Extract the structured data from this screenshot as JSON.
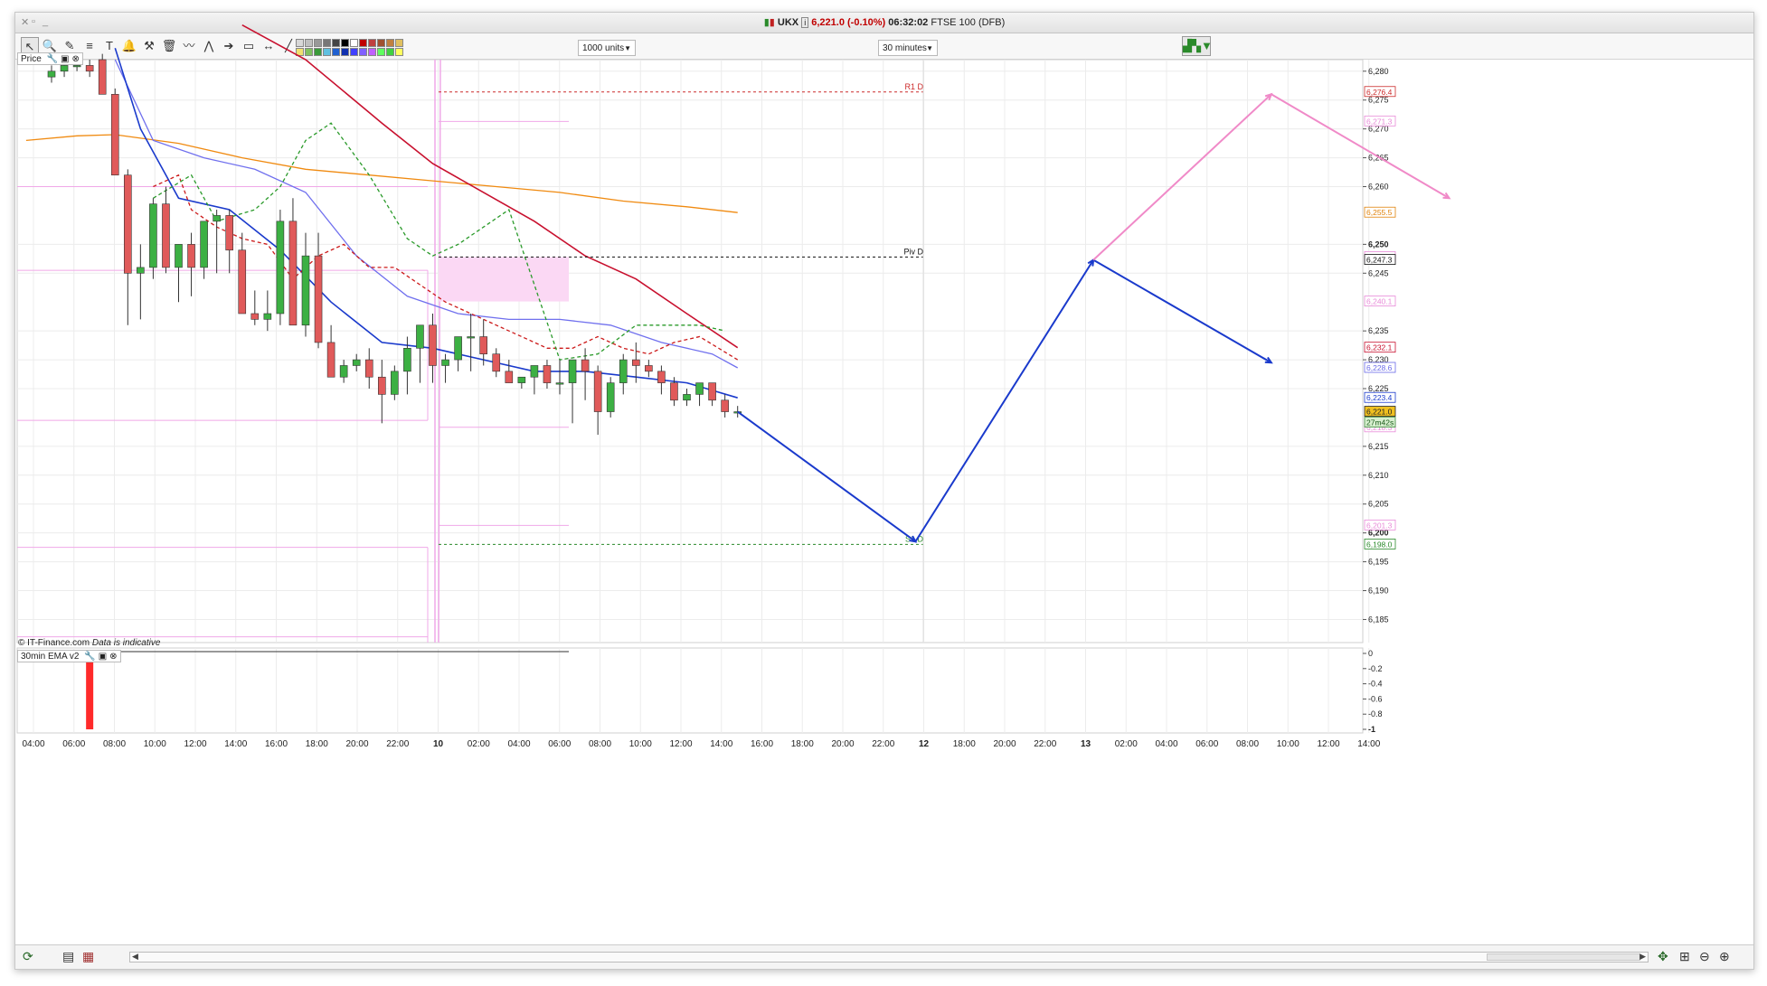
{
  "titlebar": {
    "symbol": "UKX",
    "info_icon": "info-icon",
    "price": "6,221.0",
    "change": "(-0.10%)",
    "time": "06:32:02",
    "name": "FTSE 100 (DFB)"
  },
  "toolbar": {
    "units_label": "1000 units",
    "interval_label": "30 minutes",
    "tools": [
      "cursor-icon",
      "zoom-icon",
      "draw-icon",
      "fibonacci-icon",
      "text-icon",
      "alert-icon",
      "tools-icon",
      "delete-icon",
      "indicator-icon",
      "pattern-icon",
      "arrow-icon",
      "shape-icon",
      "line-icon",
      "pen-icon"
    ],
    "palette": [
      "#d8d8d8",
      "#bfbfbf",
      "#999999",
      "#777777",
      "#444444",
      "#000000",
      "#ffffff",
      "#c00000",
      "#c04040",
      "#a05030",
      "#c08040",
      "#e0c060",
      "#f0e070",
      "#80c060",
      "#3a9a3a",
      "#60c0e0",
      "#2060d0",
      "#1030b0",
      "#4040ff",
      "#8060ff",
      "#c060ff",
      "#60ff60",
      "#40d040",
      "#ffff60"
    ],
    "chart_type_icon": "chart-type-icon"
  },
  "pane_labels": {
    "price": "Price",
    "ema": "30min EMA v2",
    "copyright": "© IT-Finance.com",
    "disclaimer": "Data is indicative"
  },
  "bottombar": {
    "tools": [
      "refresh-icon",
      "layout-icon",
      "layers-icon"
    ],
    "right_tools": [
      "crosshair-icon",
      "zoom-fit-icon",
      "zoom-out-icon",
      "zoom-in-icon"
    ]
  },
  "chart_data": {
    "type": "candlestick",
    "title": "UKX FTSE 100 (DFB)",
    "interval": "30 minutes",
    "ylim": [
      6181,
      6282
    ],
    "y_ticks": [
      "6,280",
      "6,275",
      "6,270",
      "6,265",
      "6,260",
      "6,250",
      "6,245",
      "6,235",
      "6,230",
      "6,225",
      "6,215",
      "6,210",
      "6,205",
      "6,200",
      "6,195",
      "6,190",
      "6,185"
    ],
    "bold_y_ticks": [
      "6,250",
      "6,200"
    ],
    "x_tick_labels": [
      "04:00",
      "06:00",
      "08:00",
      "10:00",
      "12:00",
      "14:00",
      "16:00",
      "18:00",
      "20:00",
      "22:00",
      "10",
      "02:00",
      "04:00",
      "06:00",
      "08:00",
      "10:00",
      "12:00",
      "14:00",
      "16:00",
      "18:00",
      "20:00",
      "22:00",
      "12",
      "18:00",
      "20:00",
      "22:00",
      "13",
      "02:00",
      "04:00",
      "06:00",
      "08:00",
      "10:00",
      "12:00",
      "14:00"
    ],
    "bold_x_ticks": [
      "10",
      "12",
      "13"
    ],
    "candles": [
      {
        "t": 0,
        "o": 6279,
        "h": 6281,
        "l": 6278,
        "c": 6280
      },
      {
        "t": 1,
        "o": 6280,
        "h": 6282,
        "l": 6279,
        "c": 6281
      },
      {
        "t": 2,
        "o": 6281,
        "h": 6282,
        "l": 6280,
        "c": 6281
      },
      {
        "t": 3,
        "o": 6281,
        "h": 6282,
        "l": 6279,
        "c": 6280
      },
      {
        "t": 4,
        "o": 6282,
        "h": 6283,
        "l": 6276,
        "c": 6276
      },
      {
        "t": 5,
        "o": 6276,
        "h": 6277,
        "l": 6262,
        "c": 6262
      },
      {
        "t": 6,
        "o": 6262,
        "h": 6263,
        "l": 6236,
        "c": 6245
      },
      {
        "t": 7,
        "o": 6245,
        "h": 6250,
        "l": 6237,
        "c": 6246
      },
      {
        "t": 8,
        "o": 6246,
        "h": 6258,
        "l": 6244,
        "c": 6257
      },
      {
        "t": 9,
        "o": 6257,
        "h": 6260,
        "l": 6245,
        "c": 6246
      },
      {
        "t": 10,
        "o": 6246,
        "h": 6250,
        "l": 6240,
        "c": 6250
      },
      {
        "t": 11,
        "o": 6250,
        "h": 6252,
        "l": 6241,
        "c": 6246
      },
      {
        "t": 12,
        "o": 6246,
        "h": 6252,
        "l": 6244,
        "c": 6254
      },
      {
        "t": 13,
        "o": 6254,
        "h": 6256,
        "l": 6245,
        "c": 6255
      },
      {
        "t": 14,
        "o": 6255,
        "h": 6256,
        "l": 6245,
        "c": 6249
      },
      {
        "t": 15,
        "o": 6249,
        "h": 6252,
        "l": 6238,
        "c": 6238
      },
      {
        "t": 16,
        "o": 6238,
        "h": 6242,
        "l": 6236,
        "c": 6237
      },
      {
        "t": 17,
        "o": 6237,
        "h": 6242,
        "l": 6235,
        "c": 6238
      },
      {
        "t": 18,
        "o": 6238,
        "h": 6256,
        "l": 6236,
        "c": 6254
      },
      {
        "t": 19,
        "o": 6254,
        "h": 6258,
        "l": 6236,
        "c": 6236
      },
      {
        "t": 20,
        "o": 6236,
        "h": 6252,
        "l": 6234,
        "c": 6248
      },
      {
        "t": 21,
        "o": 6248,
        "h": 6252,
        "l": 6232,
        "c": 6233
      },
      {
        "t": 22,
        "o": 6233,
        "h": 6236,
        "l": 6227,
        "c": 6227
      },
      {
        "t": 23,
        "o": 6227,
        "h": 6230,
        "l": 6226,
        "c": 6229
      },
      {
        "t": 24,
        "o": 6229,
        "h": 6231,
        "l": 6228,
        "c": 6230
      },
      {
        "t": 25,
        "o": 6230,
        "h": 6232,
        "l": 6225,
        "c": 6227
      },
      {
        "t": 26,
        "o": 6227,
        "h": 6230,
        "l": 6219,
        "c": 6224
      },
      {
        "t": 27,
        "o": 6224,
        "h": 6229,
        "l": 6223,
        "c": 6228
      },
      {
        "t": 28,
        "o": 6228,
        "h": 6234,
        "l": 6224,
        "c": 6232
      },
      {
        "t": 29,
        "o": 6232,
        "h": 6236,
        "l": 6226,
        "c": 6236
      },
      {
        "t": 30,
        "o": 6236,
        "h": 6238,
        "l": 6226,
        "c": 6229
      },
      {
        "t": 31,
        "o": 6229,
        "h": 6231,
        "l": 6226,
        "c": 6230
      },
      {
        "t": 32,
        "o": 6230,
        "h": 6233,
        "l": 6228,
        "c": 6234
      },
      {
        "t": 33,
        "o": 6234,
        "h": 6238,
        "l": 6228,
        "c": 6234
      },
      {
        "t": 34,
        "o": 6234,
        "h": 6237,
        "l": 6229,
        "c": 6231
      },
      {
        "t": 35,
        "o": 6231,
        "h": 6232,
        "l": 6227,
        "c": 6228
      },
      {
        "t": 36,
        "o": 6228,
        "h": 6230,
        "l": 6226,
        "c": 6226
      },
      {
        "t": 37,
        "o": 6226,
        "h": 6227,
        "l": 6225,
        "c": 6227
      },
      {
        "t": 38,
        "o": 6227,
        "h": 6229,
        "l": 6224,
        "c": 6229
      },
      {
        "t": 39,
        "o": 6229,
        "h": 6230,
        "l": 6225,
        "c": 6226
      },
      {
        "t": 40,
        "o": 6226,
        "h": 6230,
        "l": 6224,
        "c": 6226
      },
      {
        "t": 41,
        "o": 6226,
        "h": 6230,
        "l": 6219,
        "c": 6230
      },
      {
        "t": 42,
        "o": 6230,
        "h": 6232,
        "l": 6223,
        "c": 6228
      },
      {
        "t": 43,
        "o": 6228,
        "h": 6229,
        "l": 6217,
        "c": 6221
      },
      {
        "t": 44,
        "o": 6221,
        "h": 6227,
        "l": 6220,
        "c": 6226
      },
      {
        "t": 45,
        "o": 6226,
        "h": 6231,
        "l": 6224,
        "c": 6230
      },
      {
        "t": 46,
        "o": 6230,
        "h": 6233,
        "l": 6226,
        "c": 6229
      },
      {
        "t": 47,
        "o": 6229,
        "h": 6230,
        "l": 6227,
        "c": 6228
      },
      {
        "t": 48,
        "o": 6228,
        "h": 6229,
        "l": 6224,
        "c": 6226
      },
      {
        "t": 49,
        "o": 6226,
        "h": 6227,
        "l": 6222,
        "c": 6223
      },
      {
        "t": 50,
        "o": 6223,
        "h": 6225,
        "l": 6222,
        "c": 6224
      },
      {
        "t": 51,
        "o": 6224,
        "h": 6226,
        "l": 6222,
        "c": 6226
      },
      {
        "t": 52,
        "o": 6226,
        "h": 6226,
        "l": 6222,
        "c": 6223
      },
      {
        "t": 53,
        "o": 6223,
        "h": 6224,
        "l": 6220,
        "c": 6221
      },
      {
        "t": 54,
        "o": 6221,
        "h": 6222,
        "l": 6220,
        "c": 6221
      }
    ],
    "levels": [
      {
        "name": "R1 D",
        "value": 6276.4,
        "color": "#cc2a2a",
        "style": "dashed"
      },
      {
        "name": "Piv D",
        "value": 6247.8,
        "color": "#111111",
        "style": "dashed"
      },
      {
        "name": "S1 D",
        "value": 6198.0,
        "color": "#2a8a2a",
        "style": "dashed"
      }
    ],
    "price_tags": [
      {
        "value": 6276.4,
        "label": "6,276.4",
        "color": "#cc2a2a",
        "bg": "#ffffff"
      },
      {
        "value": 6271.3,
        "label": "6,271.3",
        "color": "#e88ad8",
        "bg": "#ffffff"
      },
      {
        "value": 6255.5,
        "label": "6,255.5",
        "color": "#e0820a",
        "bg": "#ffffff"
      },
      {
        "value": 6247.8,
        "label": "6,247.8",
        "color": "#e88ad8",
        "bg": "#ffffff"
      },
      {
        "value": 6247.3,
        "label": "6,247.3",
        "color": "#111111",
        "bg": "#ffffff"
      },
      {
        "value": 6240.1,
        "label": "6,240.1",
        "color": "#e88ad8",
        "bg": "#ffffff"
      },
      {
        "value": 6232.1,
        "label": "6,232.1",
        "color": "#c8102e",
        "bg": "#ffffff"
      },
      {
        "value": 6228.6,
        "label": "6,228.6",
        "color": "#6a6ae8",
        "bg": "#ffffff"
      },
      {
        "value": 6223.4,
        "label": "6,223.4",
        "color": "#1a3acc",
        "bg": "#ffffff"
      },
      {
        "value": 6221.0,
        "label": "6,221.0",
        "color": "#222222",
        "bg": "#f0c020"
      },
      {
        "value": 6218.3,
        "label": "6,218.3",
        "color": "#e88ad8",
        "bg": "#ffffff"
      },
      {
        "value": 6201.3,
        "label": "6,201.3",
        "color": "#e88ad8",
        "bg": "#ffffff"
      },
      {
        "value": 6198.0,
        "label": "6,198.0",
        "color": "#2a8a2a",
        "bg": "#ffffff"
      }
    ],
    "countdown": "27m42s",
    "forecast_blue": [
      [
        54,
        6221
      ],
      [
        68,
        6198.5
      ],
      [
        82,
        6247.3
      ],
      [
        96,
        6229.5
      ]
    ],
    "forecast_pink": [
      [
        82,
        6247.3
      ],
      [
        96,
        6276
      ],
      [
        110,
        6258
      ]
    ],
    "ema_pane": {
      "y_ticks": [
        "0",
        "-0.2",
        "-0.4",
        "-0.6",
        "-0.8",
        "-1"
      ],
      "ylim": [
        -1,
        0
      ],
      "bar_at": 3,
      "bar_value": -1,
      "bar_color": "#ff2a2a"
    }
  }
}
